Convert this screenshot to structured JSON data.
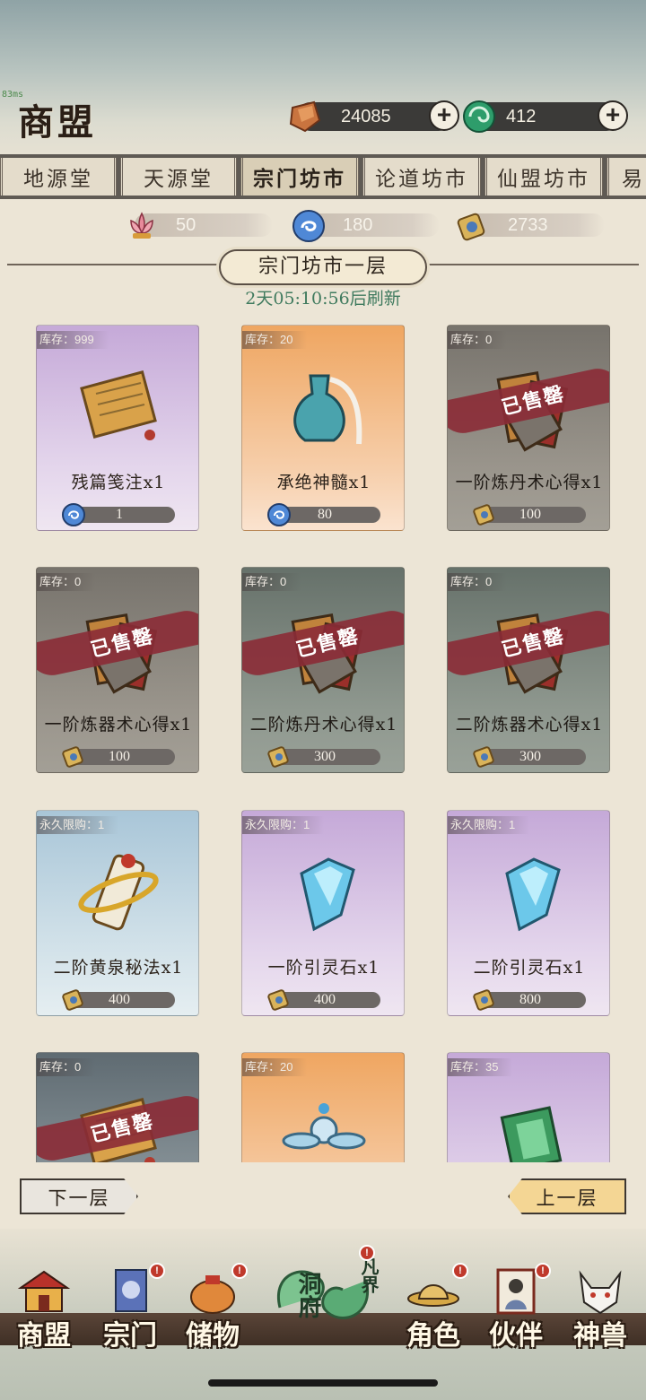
{
  "debug": {
    "fps": "83ms"
  },
  "header": {
    "title": "商盟",
    "currencies": [
      {
        "name": "ore-icon",
        "value": "24085"
      },
      {
        "name": "jade-icon",
        "value": "412"
      }
    ],
    "plus_label": "+"
  },
  "tabs": [
    {
      "label": "地源堂",
      "active": false
    },
    {
      "label": "天源堂",
      "active": false
    },
    {
      "label": "宗门坊市",
      "active": true
    },
    {
      "label": "论道坊市",
      "active": false
    },
    {
      "label": "仙盟坊市",
      "active": false
    },
    {
      "label": "易",
      "active": false
    }
  ],
  "shop_currencies": [
    {
      "icon": "lotus-icon",
      "value": "50"
    },
    {
      "icon": "spirit-orb-icon",
      "value": "180"
    },
    {
      "icon": "sect-token-icon",
      "value": "2733"
    }
  ],
  "floor": {
    "title": "宗门坊市一层",
    "refresh": "2天05:10:56后刷新"
  },
  "sold_out_label": "已售罄",
  "items": [
    {
      "stock": "库存：999",
      "name": "残篇笺注x1",
      "price": "1",
      "currency": "spirit-orb-icon",
      "color": "purple",
      "art": "scroll-icon",
      "sold": false
    },
    {
      "stock": "库存：20",
      "name": "承绝神髓x1",
      "price": "80",
      "currency": "spirit-orb-icon",
      "color": "orange",
      "art": "vase-icon",
      "sold": false
    },
    {
      "stock": "库存：0",
      "name": "一阶炼丹术心得x1",
      "price": "100",
      "currency": "sect-token-icon",
      "color": "grey",
      "art": "book-icon",
      "sold": true
    },
    {
      "stock": "库存：0",
      "name": "一阶炼器术心得x1",
      "price": "100",
      "currency": "sect-token-icon",
      "color": "grey",
      "art": "book-icon",
      "sold": true
    },
    {
      "stock": "库存：0",
      "name": "二阶炼丹术心得x1",
      "price": "300",
      "currency": "sect-token-icon",
      "color": "grey-green",
      "art": "book-icon",
      "sold": true
    },
    {
      "stock": "库存：0",
      "name": "二阶炼器术心得x1",
      "price": "300",
      "currency": "sect-token-icon",
      "color": "grey-green",
      "art": "book-icon",
      "sold": true
    },
    {
      "stock": "永久限购：1",
      "name": "二阶黄泉秘法x1",
      "price": "400",
      "currency": "sect-token-icon",
      "color": "blue",
      "art": "golden-scroll-icon",
      "sold": false
    },
    {
      "stock": "永久限购：1",
      "name": "一阶引灵石x1",
      "price": "400",
      "currency": "sect-token-icon",
      "color": "purple",
      "art": "crystal-icon",
      "sold": false
    },
    {
      "stock": "永久限购：1",
      "name": "二阶引灵石x1",
      "price": "800",
      "currency": "sect-token-icon",
      "color": "purple",
      "art": "crystal-icon",
      "sold": false
    },
    {
      "stock": "库存：0",
      "name": "",
      "price": "",
      "currency": "",
      "color": "grey-blue",
      "art": "scroll-icon",
      "sold": true
    },
    {
      "stock": "库存：20",
      "name": "",
      "price": "",
      "currency": "",
      "color": "orange",
      "art": "flower-icon",
      "sold": false
    },
    {
      "stock": "库存：35",
      "name": "",
      "price": "",
      "currency": "",
      "color": "purple",
      "art": "green-book-icon",
      "sold": false
    }
  ],
  "paging": {
    "next": "下一层",
    "prev": "上一层"
  },
  "nav": [
    {
      "label": "商盟",
      "icon": "pavilion-icon",
      "badge": false
    },
    {
      "label": "宗门",
      "icon": "banner-icon",
      "badge": true
    },
    {
      "label": "储物",
      "icon": "bag-icon",
      "badge": true
    },
    {
      "label": "角色",
      "icon": "hat-icon",
      "badge": true
    },
    {
      "label": "伙伴",
      "icon": "portrait-icon",
      "badge": true
    },
    {
      "label": "神兽",
      "icon": "fox-icon",
      "badge": false
    }
  ],
  "center_nav": {
    "left": "洞府",
    "right": "凡界",
    "badge": true
  },
  "badge_mark": "!"
}
